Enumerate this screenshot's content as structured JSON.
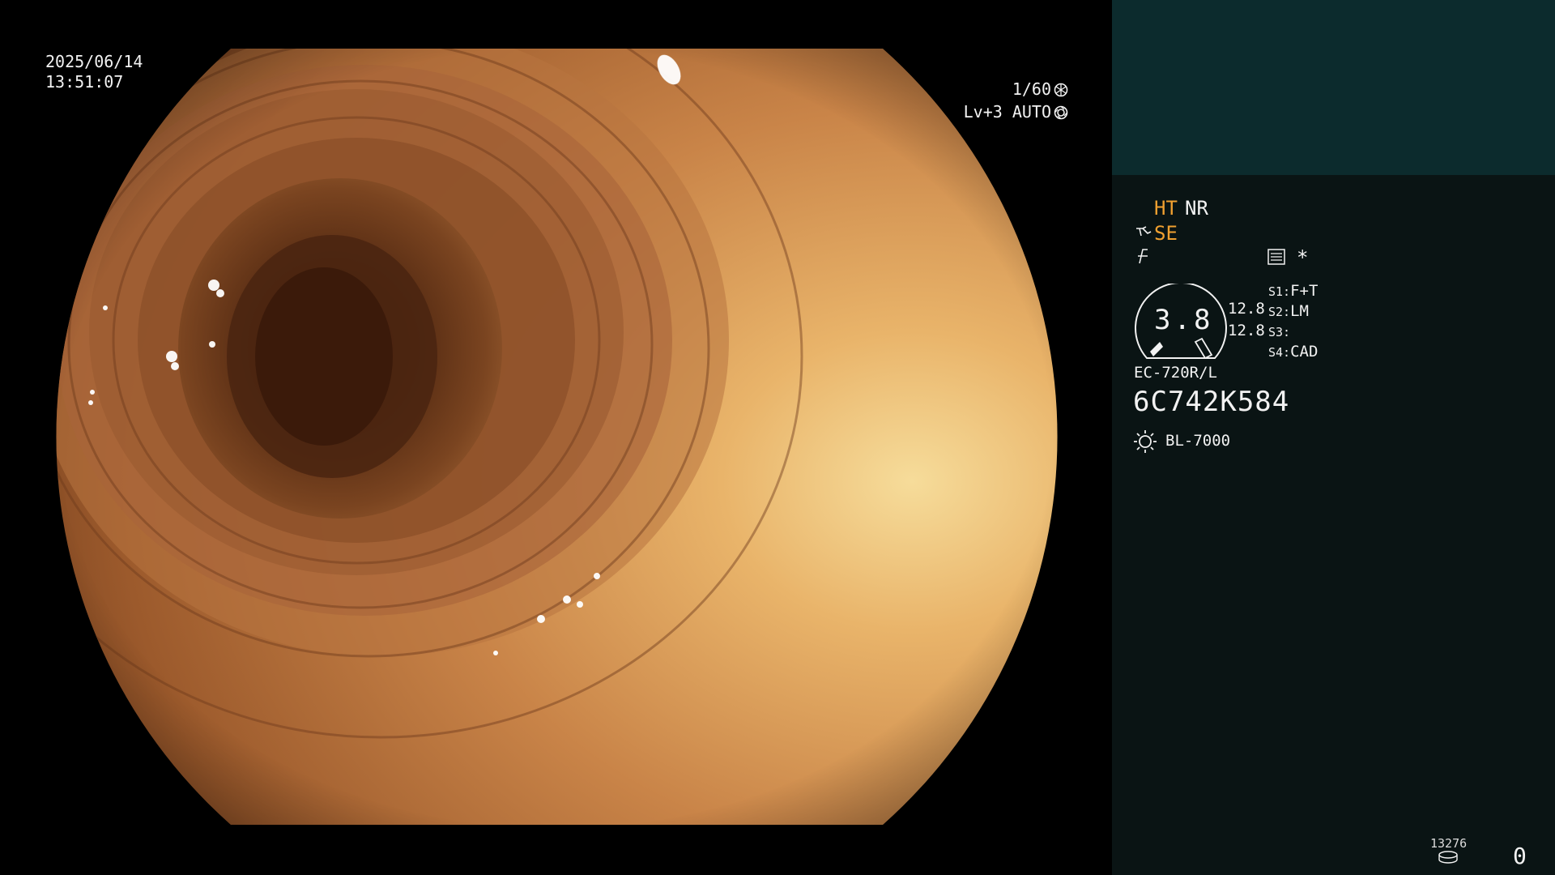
{
  "osd": {
    "date": "2025/06/14",
    "time": "13:51:07",
    "shutter": "1/60",
    "level": "Lv+3 AUTO"
  },
  "panel": {
    "ht": "HT",
    "nr": "NR",
    "se": "SE",
    "asterisk": "*",
    "gauge_value": "3.8",
    "value_upper": "12.8",
    "value_lower": "12.8",
    "switches": [
      {
        "key": "S1:",
        "value": "F+T"
      },
      {
        "key": "S2:",
        "value": "LM"
      },
      {
        "key": "S3:",
        "value": ""
      },
      {
        "key": "S4:",
        "value": "CAD"
      }
    ],
    "scope_model": "EC-720R/L",
    "scope_serial": "6C742K584",
    "light_source": "BL-7000",
    "counter_number": "13276",
    "counter_value": "0"
  },
  "colors": {
    "highlight": "#f0a030",
    "panel_bg": "#0a1414",
    "panel_top": "#0c2b2d"
  },
  "icons": [
    "shutter-icon",
    "iris-icon",
    "scope-icon",
    "freeze-icon",
    "memo-icon",
    "light-source-icon",
    "recorder-icon"
  ]
}
